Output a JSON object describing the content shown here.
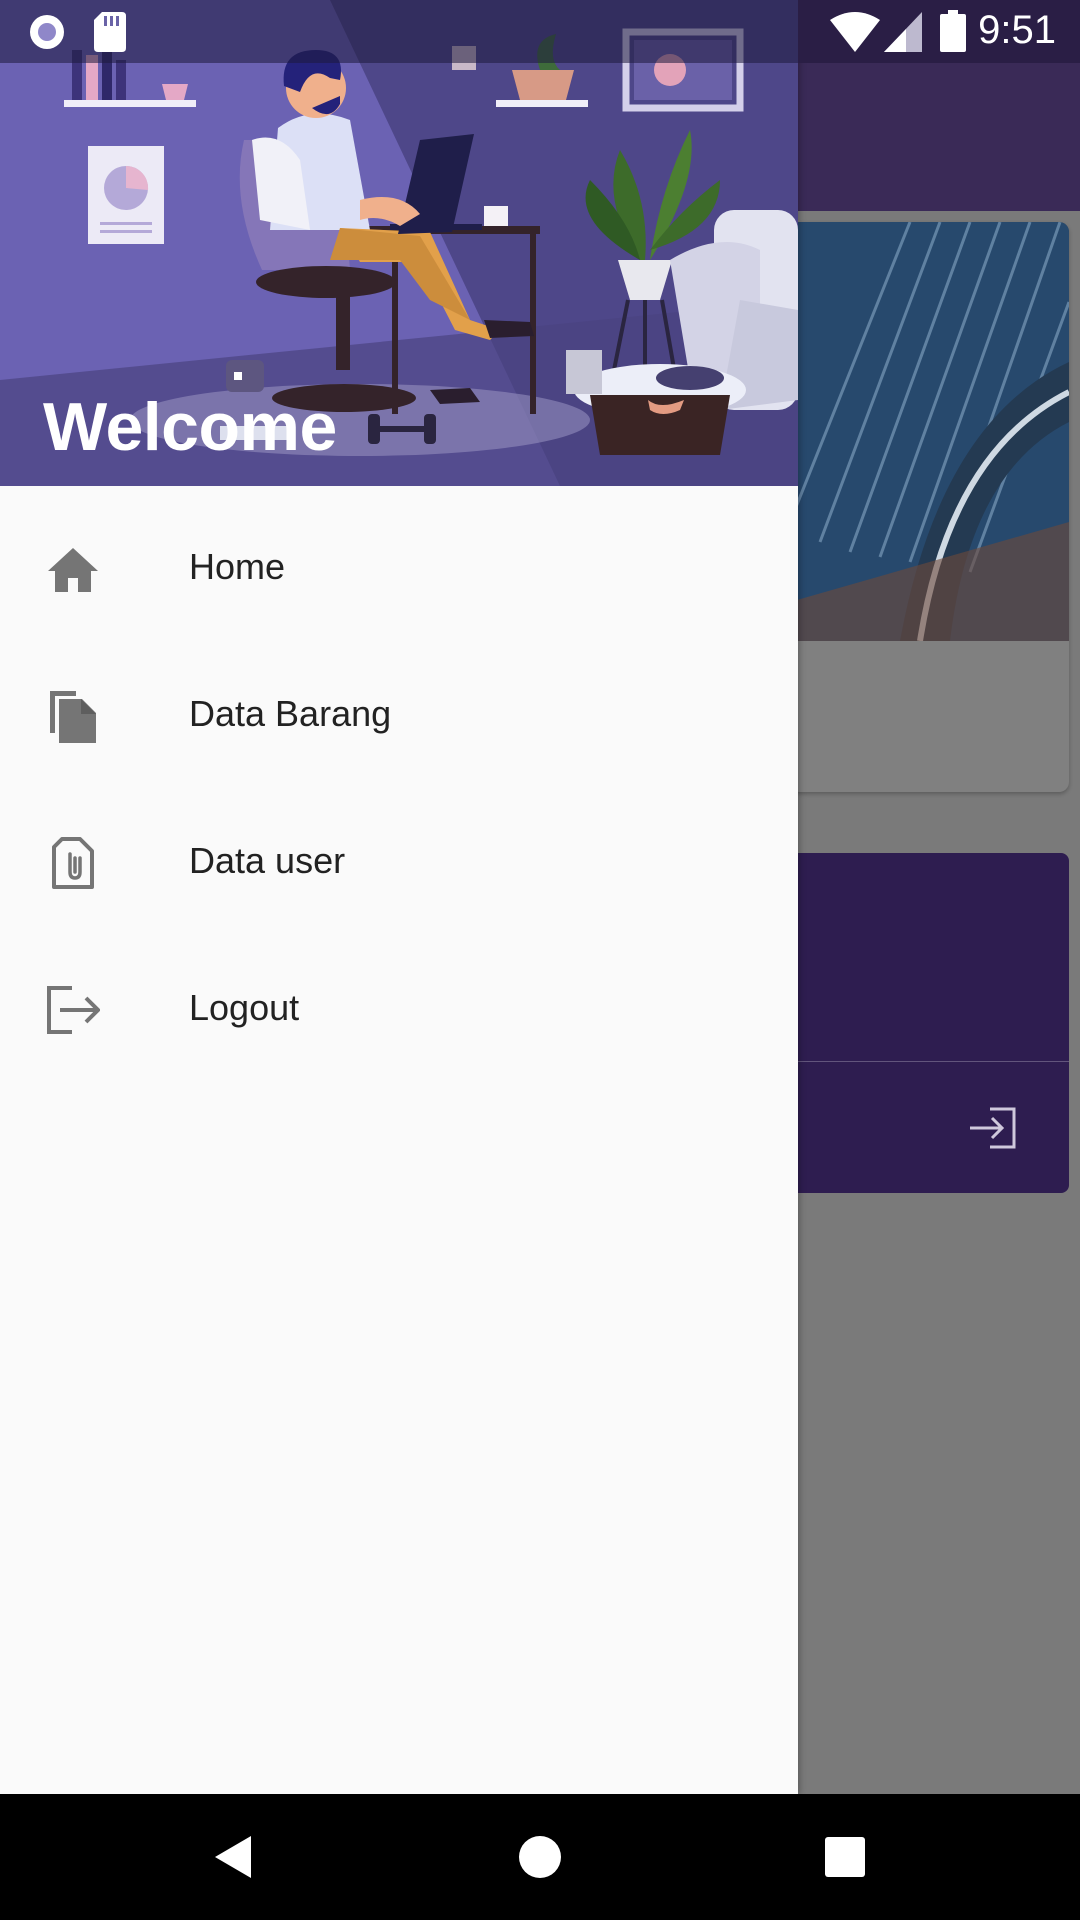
{
  "status_bar": {
    "time": "9:51",
    "icons": [
      "record-icon",
      "sd-card-icon",
      "wifi-icon",
      "cellular-signal-icon",
      "battery-icon"
    ]
  },
  "drawer": {
    "header": {
      "welcome_text": "Welcome",
      "illustration": "person-working-on-laptop-illustration"
    },
    "menu": [
      {
        "label": "Home",
        "icon": "home-icon"
      },
      {
        "label": "Data Barang",
        "icon": "file-icon"
      },
      {
        "label": "Data user",
        "icon": "attachment-file-icon"
      },
      {
        "label": "Logout",
        "icon": "logout-icon"
      }
    ]
  },
  "nav_bar": {
    "buttons": [
      "back-icon",
      "home-circle-icon",
      "recents-square-icon"
    ]
  },
  "colors": {
    "drawer_header": "#5a509a",
    "app_bar": "#3a2a57",
    "card_purple": "#2e1d50",
    "drawer_bg": "#fafafa",
    "icon_gray": "#757575"
  }
}
